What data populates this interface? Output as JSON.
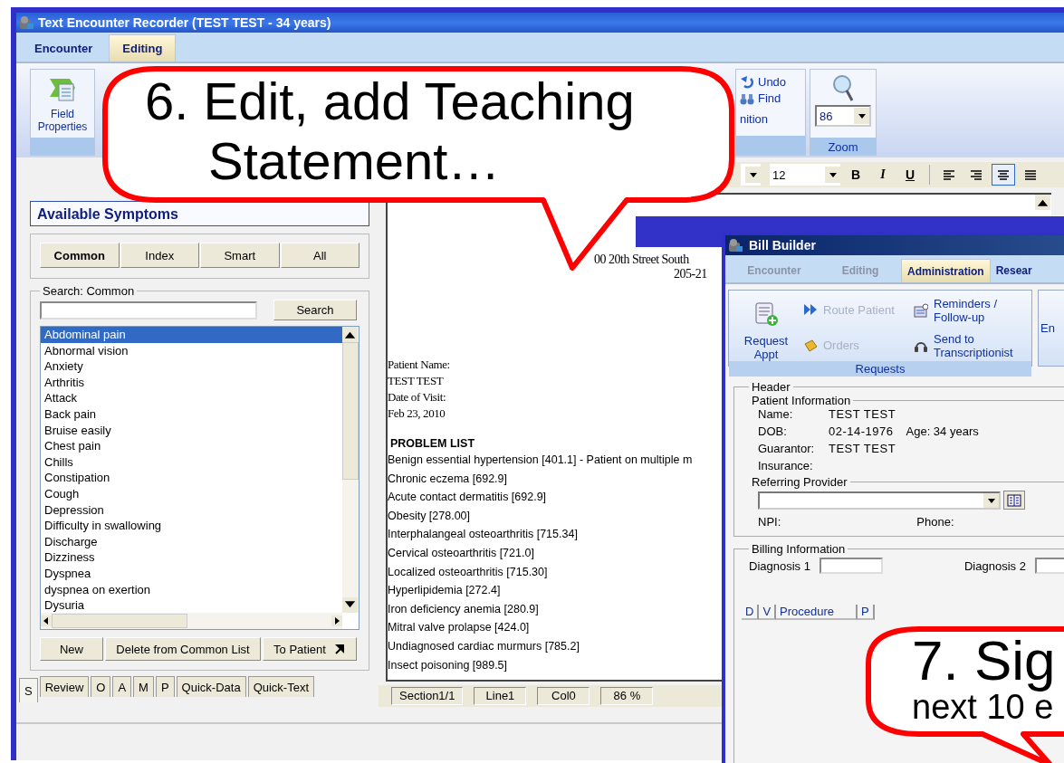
{
  "main_window": {
    "title": "Text Encounter Recorder (TEST TEST - 34 years)",
    "tabs": [
      {
        "label": "Encounter",
        "selected": false
      },
      {
        "label": "Editing",
        "selected": true
      }
    ],
    "ribbon": {
      "field_button": "Field Properties",
      "undo": "Undo",
      "find": "Find",
      "group_label": "nition",
      "zoom": {
        "value": "86",
        "label": "Zoom"
      }
    },
    "format_toolbar": {
      "font_size": "12",
      "buttons": [
        {
          "kind": "bold",
          "label": "B",
          "selected": false
        },
        {
          "kind": "italic",
          "label": "I",
          "selected": false
        },
        {
          "kind": "underline",
          "label": "U",
          "selected": false
        },
        {
          "kind": "align-left",
          "selected": false
        },
        {
          "kind": "align-right",
          "selected": false
        },
        {
          "kind": "align-center",
          "selected": true
        },
        {
          "kind": "justify",
          "selected": false
        }
      ]
    },
    "symptoms_panel": {
      "title": "Available Symptoms",
      "filter_buttons": [
        {
          "label": "Common",
          "selected": true
        },
        {
          "label": "Index",
          "selected": false
        },
        {
          "label": "Smart",
          "selected": false
        },
        {
          "label": "All",
          "selected": false
        }
      ],
      "search_label": "Search: Common",
      "search_button": "Search",
      "items": [
        {
          "label": "Abdominal pain",
          "selected": true
        },
        {
          "label": "Abnormal vision",
          "selected": false
        },
        {
          "label": "Anxiety",
          "selected": false
        },
        {
          "label": "Arthritis",
          "selected": false
        },
        {
          "label": "Attack",
          "selected": false
        },
        {
          "label": "Back pain",
          "selected": false
        },
        {
          "label": "Bruise easily",
          "selected": false
        },
        {
          "label": "Chest pain",
          "selected": false
        },
        {
          "label": "Chills",
          "selected": false
        },
        {
          "label": "Constipation",
          "selected": false
        },
        {
          "label": "Cough",
          "selected": false
        },
        {
          "label": "Depression",
          "selected": false
        },
        {
          "label": "Difficulty in swallowing",
          "selected": false
        },
        {
          "label": "Discharge",
          "selected": false
        },
        {
          "label": "Dizziness",
          "selected": false
        },
        {
          "label": "Dyspnea",
          "selected": false
        },
        {
          "label": "dyspnea on exertion",
          "selected": false
        },
        {
          "label": "Dysuria",
          "selected": false
        }
      ],
      "buttons": [
        "New",
        "Delete from Common List",
        "To Patient"
      ]
    },
    "bottom_tabs": [
      {
        "label": "S",
        "selected": true
      },
      {
        "label": "Review",
        "selected": false
      },
      {
        "label": "O",
        "selected": false
      },
      {
        "label": "A",
        "selected": false
      },
      {
        "label": "M",
        "selected": false
      },
      {
        "label": "P",
        "selected": false
      },
      {
        "label": "Quick-Data",
        "selected": false
      },
      {
        "label": "Quick-Text",
        "selected": false
      }
    ],
    "document": {
      "address": [
        "00 20th Street South",
        "205-21"
      ],
      "fields": [
        {
          "label": "Patient Name:",
          "value": "TEST TEST"
        },
        {
          "label": "Date of Visit:",
          "value": "Feb 23, 2010"
        }
      ],
      "section_title": "PROBLEM LIST",
      "problems": [
        "Benign essential hypertension [401.1] - Patient on multiple m",
        "Chronic eczema [692.9]",
        "Acute contact dermatitis [692.9]",
        "Obesity [278.00]",
        "Interphalangeal osteoarthritis [715.34]",
        "Cervical osteoarthritis [721.0]",
        "Localized osteoarthritis [715.30]",
        "Hyperlipidemia [272.4]",
        "Iron deficiency anemia [280.9]",
        "Mitral valve prolapse [424.0]",
        "Undiagnosed cardiac murmurs [785.2]",
        "Insect poisoning [989.5]"
      ],
      "status": [
        "Section1/1",
        "Line1",
        "Col0",
        "86 %"
      ]
    }
  },
  "bill_builder": {
    "title": "Bill Builder",
    "tabs": [
      {
        "label": "Encounter",
        "selected": false,
        "disabled": true
      },
      {
        "label": "Editing",
        "selected": false,
        "disabled": true
      },
      {
        "label": "Administration",
        "selected": true,
        "disabled": false
      },
      {
        "label": "Resear",
        "selected": false,
        "disabled": false
      }
    ],
    "requests": {
      "label": "Requests",
      "big_action": "Request Appt",
      "actions": [
        {
          "kind": "route",
          "label": "Route Patient",
          "disabled": true
        },
        {
          "kind": "reminders",
          "label": "Reminders / Follow-up",
          "disabled": false
        },
        {
          "kind": "orders",
          "label": "Orders",
          "disabled": true
        },
        {
          "kind": "transcription",
          "label": "Send to Transcriptionist",
          "disabled": false
        }
      ],
      "next_group_cut": "En"
    },
    "header": {
      "title": "Header",
      "patient_title": "Patient Information",
      "rows": [
        {
          "label": "Name:",
          "value": "TEST TEST"
        },
        {
          "label": "DOB:",
          "value": "02-14-1976",
          "extra": "Age: 34 years"
        },
        {
          "label": "Guarantor:",
          "value": "TEST TEST"
        },
        {
          "label": "Insurance:"
        }
      ],
      "referring_title": "Referring Provider",
      "npi_label": "NPI:",
      "phone_label": "Phone:"
    },
    "billing": {
      "title": "Billing Information",
      "diagnosis_labels": [
        "Diagnosis 1",
        "Diagnosis 2"
      ],
      "columns": [
        "D",
        "V",
        "Procedure",
        "P"
      ]
    }
  },
  "callouts": [
    {
      "kind": "top",
      "lines": [
        "6. Edit, add Teaching",
        "Statement…"
      ]
    },
    {
      "kind": "bottom",
      "lines": [
        "7. Sig",
        "next 10 e"
      ]
    }
  ]
}
